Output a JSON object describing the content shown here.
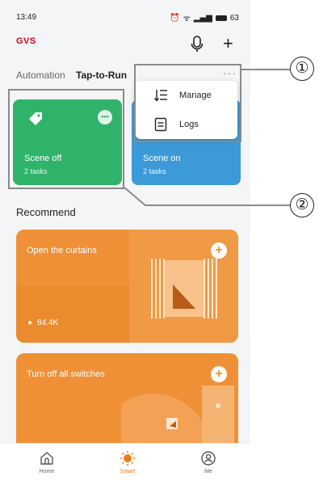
{
  "status": {
    "time": "13:49",
    "battery": "63"
  },
  "header": {
    "logo": "GVS"
  },
  "tabs": [
    {
      "label": "Automation"
    },
    {
      "label": "Tap-to-Run"
    }
  ],
  "menu": {
    "more": "···",
    "items": [
      {
        "label": "Manage",
        "icon": "list-sort-icon"
      },
      {
        "label": "Logs",
        "icon": "log-document-icon"
      }
    ]
  },
  "scenes": [
    {
      "title": "Scene off",
      "tasks": "2 tasks",
      "color": "#2fb36a"
    },
    {
      "title": "Scene on",
      "tasks": "2 tasks",
      "color": "#3d9ad9"
    }
  ],
  "recommend": {
    "title": "Recommend",
    "cards": [
      {
        "title": "Open the curtains",
        "likes": "84.4K",
        "color": "#ef9037"
      },
      {
        "title": "Turn off all switches",
        "color": "#ef9037"
      }
    ]
  },
  "nav": [
    {
      "label": "Home"
    },
    {
      "label": "Smart"
    },
    {
      "label": "Me"
    }
  ],
  "annotations": [
    {
      "label": "①"
    },
    {
      "label": "②"
    }
  ]
}
